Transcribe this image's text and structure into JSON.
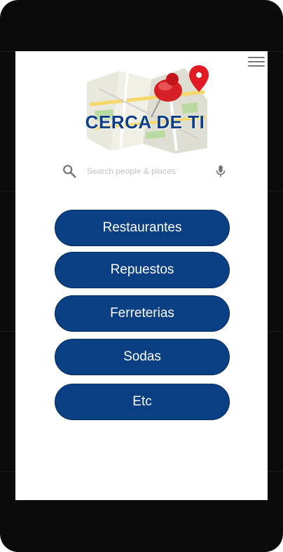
{
  "app": {
    "title": "CERCA DE TI"
  },
  "header": {
    "menu_icon": "hamburger-menu-icon"
  },
  "search": {
    "placeholder": "Search people & places",
    "value": "",
    "search_icon": "search-icon",
    "mic_icon": "mic-icon"
  },
  "categories": [
    {
      "label": "Restaurantes"
    },
    {
      "label": "Repuestos"
    },
    {
      "label": "Ferreterias"
    },
    {
      "label": "Sodas"
    },
    {
      "label": "Etc"
    }
  ],
  "colors": {
    "button_bg": "#0a3f84",
    "button_text": "#ffffff",
    "title": "#0d3f86",
    "pin": "#e01b24"
  }
}
